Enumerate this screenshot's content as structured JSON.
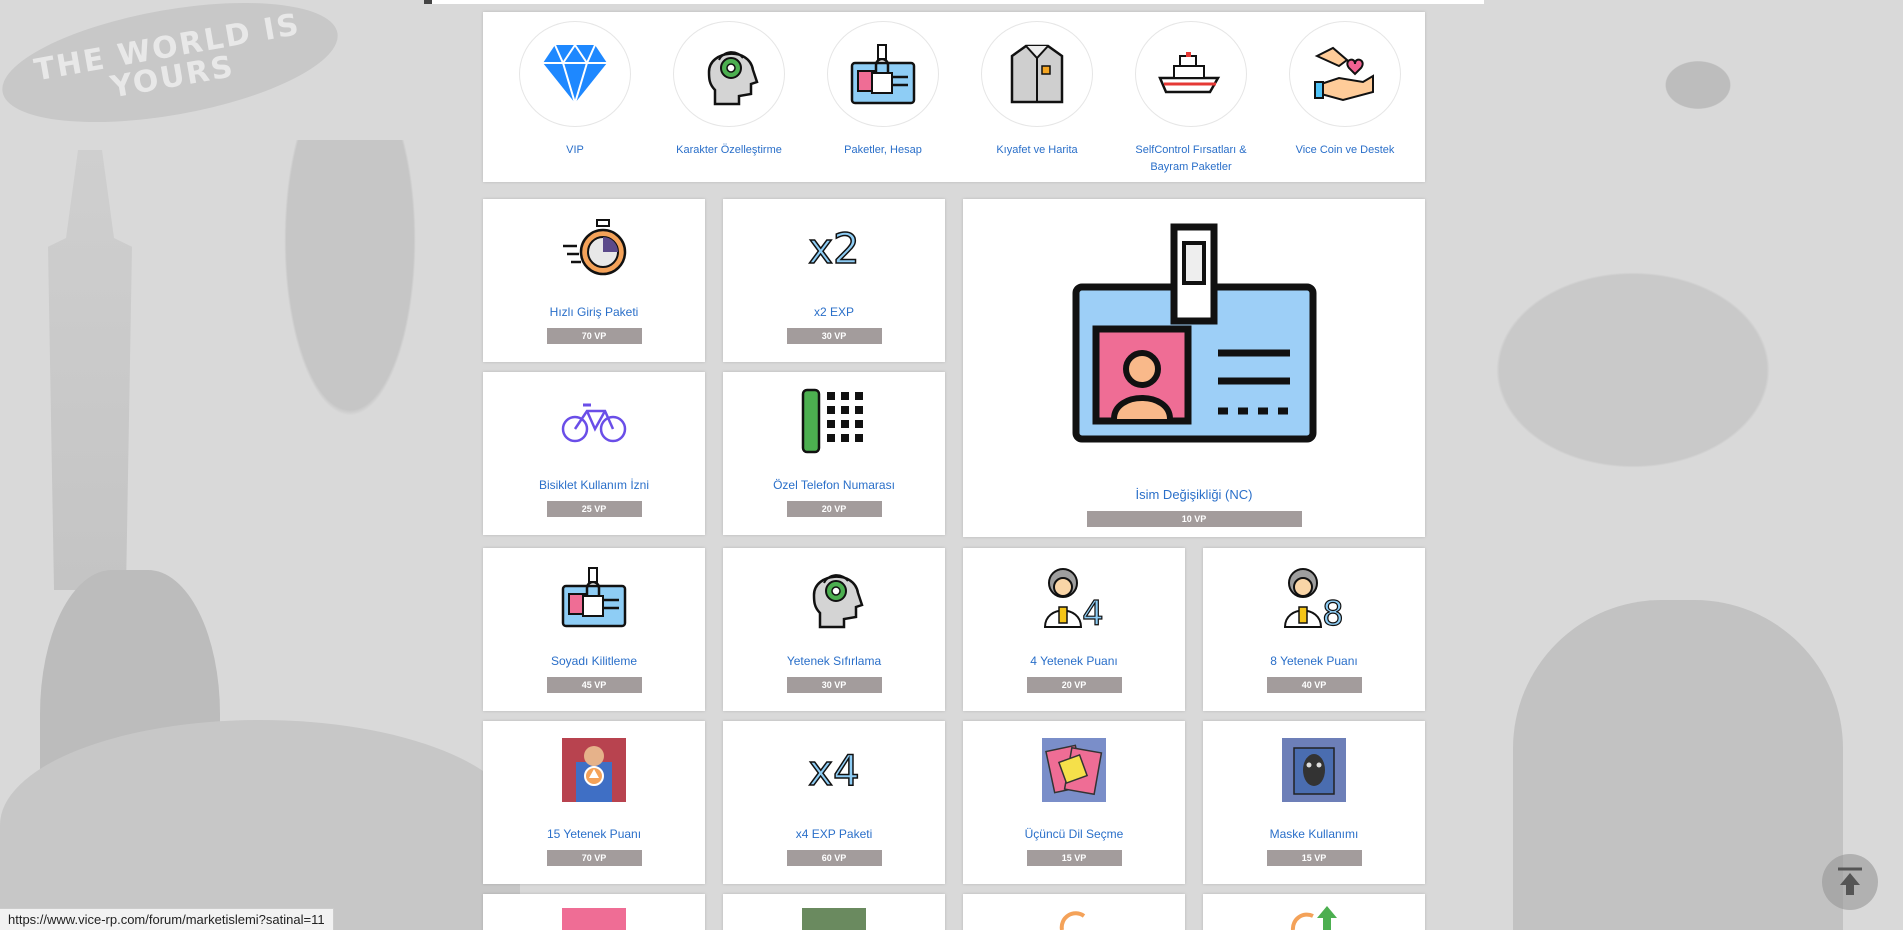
{
  "background": {
    "blimp_text": "THE WORLD IS YOURS"
  },
  "categories": [
    {
      "label": "VIP",
      "icon": "diamond-icon"
    },
    {
      "label": "Karakter Özelleştirme",
      "icon": "head-gear-icon"
    },
    {
      "label": "Paketler, Hesap",
      "icon": "locked-id-card-icon"
    },
    {
      "label": "Kıyafet ve Harita",
      "icon": "shirt-icon"
    },
    {
      "label": "SelfControl Fırsatları & Bayram Paketler",
      "icon": "ship-icon"
    },
    {
      "label": "Vice Coin ve Destek",
      "icon": "hand-heart-icon"
    }
  ],
  "products": [
    {
      "name": "Hızlı Giriş Paketi",
      "price": "70 VP",
      "icon": "stopwatch-icon"
    },
    {
      "name": "x2 EXP",
      "price": "30 VP",
      "icon": "x2-icon",
      "icon_text": "x2"
    },
    {
      "name": "İsim Değişikliği (NC)",
      "price": "10 VP",
      "icon": "id-badge-icon"
    },
    {
      "name": "Bisiklet Kullanım İzni",
      "price": "25 VP",
      "icon": "bicycle-icon"
    },
    {
      "name": "Özel Telefon Numarası",
      "price": "20 VP",
      "icon": "phone-keypad-icon"
    },
    {
      "name": "Soyadı Kilitleme",
      "price": "45 VP",
      "icon": "locked-id-card-icon"
    },
    {
      "name": "Yetenek Sıfırlama",
      "price": "30 VP",
      "icon": "head-gear-icon"
    },
    {
      "name": "4 Yetenek Puanı",
      "price": "20 VP",
      "icon": "scientist-4-icon",
      "icon_text": "4"
    },
    {
      "name": "8 Yetenek Puanı",
      "price": "40 VP",
      "icon": "scientist-8-icon",
      "icon_text": "8"
    },
    {
      "name": "15 Yetenek Puanı",
      "price": "70 VP",
      "icon": "character-photo-icon"
    },
    {
      "name": "x4 EXP Paketi",
      "price": "60 VP",
      "icon": "x4-icon",
      "icon_text": "x4"
    },
    {
      "name": "Üçüncü Dil Seçme",
      "price": "15 VP",
      "icon": "cards-photo-icon"
    },
    {
      "name": "Maske Kullanımı",
      "price": "15 VP",
      "icon": "mask-photo-icon"
    }
  ],
  "status_bar": {
    "url": "https://www.vice-rp.com/forum/marketislemi?satinal=11"
  },
  "colors": {
    "link": "#2a6fc9",
    "price_bg": "#a39c9c"
  }
}
